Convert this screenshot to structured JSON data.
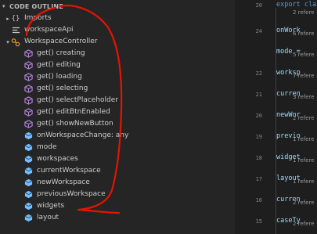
{
  "outline": {
    "header": "CODE OUTLINE",
    "items": [
      {
        "label": "Imports",
        "icon": "braces-icon",
        "twisty": "▸",
        "indent": 1
      },
      {
        "label": "workspaceApi",
        "icon": "variable-icon",
        "twisty": "",
        "indent": 1
      },
      {
        "label": "WorkspaceController",
        "icon": "class-icon",
        "twisty": "▾",
        "indent": 1
      },
      {
        "label": "get() creating",
        "icon": "method-icon",
        "twisty": "",
        "indent": 2
      },
      {
        "label": "get() editing",
        "icon": "method-icon",
        "twisty": "",
        "indent": 2
      },
      {
        "label": "get() loading",
        "icon": "method-icon",
        "twisty": "",
        "indent": 2
      },
      {
        "label": "get() selecting",
        "icon": "method-icon",
        "twisty": "",
        "indent": 2
      },
      {
        "label": "get() selectPlaceholder",
        "icon": "method-icon",
        "twisty": "",
        "indent": 2
      },
      {
        "label": "get() editBtnEnabled",
        "icon": "method-icon",
        "twisty": "",
        "indent": 2
      },
      {
        "label": "get() showNewButton",
        "icon": "method-icon",
        "twisty": "",
        "indent": 2
      },
      {
        "label": "onWorkspaceChange: any",
        "icon": "property-icon",
        "twisty": "",
        "indent": 2
      },
      {
        "label": "mode",
        "icon": "property-icon",
        "twisty": "",
        "indent": 2
      },
      {
        "label": "workspaces",
        "icon": "property-icon",
        "twisty": "",
        "indent": 2
      },
      {
        "label": "currentWorkspace",
        "icon": "property-icon",
        "twisty": "",
        "indent": 2
      },
      {
        "label": "newWorkspace",
        "icon": "property-icon",
        "twisty": "",
        "indent": 2
      },
      {
        "label": "previousWorkspace",
        "icon": "property-icon",
        "twisty": "",
        "indent": 2
      },
      {
        "label": "widgets",
        "icon": "property-icon",
        "twisty": "",
        "indent": 2
      },
      {
        "label": "layout",
        "icon": "property-icon",
        "twisty": "",
        "indent": 2
      }
    ]
  },
  "editor": {
    "gutter": [
      "20",
      "24",
      "22",
      "21",
      "20",
      "19",
      "18",
      "17",
      "16",
      "15"
    ],
    "code_lines": [
      {
        "text": "export cla",
        "kind": "keyword"
      },
      {
        "text": "onWork",
        "kind": "code"
      },
      {
        "text": "mode =",
        "kind": "code"
      },
      {
        "text": "worksp",
        "kind": "code"
      },
      {
        "text": "curren",
        "kind": "code"
      },
      {
        "text": "newWor",
        "kind": "code"
      },
      {
        "text": "previo",
        "kind": "code"
      },
      {
        "text": "widget",
        "kind": "code"
      },
      {
        "text": "layout",
        "kind": "code"
      },
      {
        "text": "curren",
        "kind": "code"
      },
      {
        "text": "caseTy",
        "kind": "code"
      }
    ],
    "lenses": [
      "2 refere",
      "6 refere",
      "5 refere",
      "7 refere",
      "3 refere",
      "2 refere",
      "1 refere",
      "1 refere",
      "1 refere",
      "2 refere",
      "2 refere"
    ]
  },
  "colors": {
    "method": "#b180d7",
    "property": "#75beff",
    "class": "#ee9d28",
    "annotation": "#e51400"
  }
}
